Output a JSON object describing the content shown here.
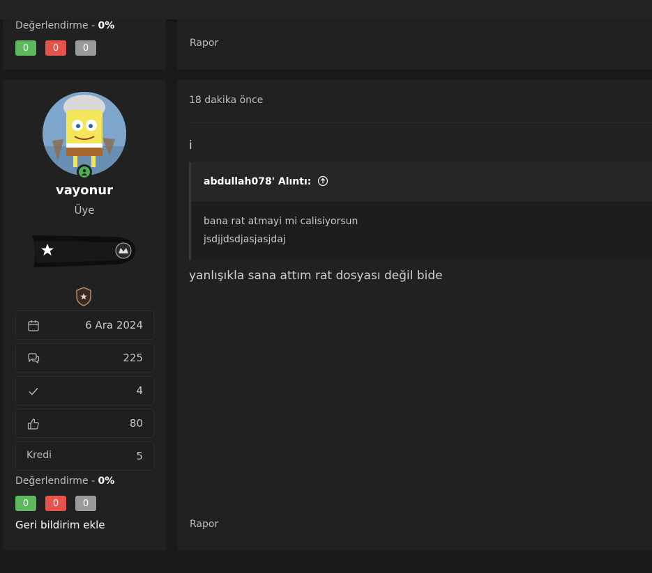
{
  "prev_post": {
    "rating_label": "Değerlendirme -",
    "rating_value": "0%",
    "badges": [
      "0",
      "0",
      "0"
    ],
    "report_label": "Rapor"
  },
  "post": {
    "username": "vayonur",
    "user_title": "Üye",
    "stats": {
      "joined": "6 Ara 2024",
      "messages": "225",
      "solutions": "4",
      "likes": "80",
      "credit_label": "Kredi",
      "credit": "5"
    },
    "rating_label": "Değerlendirme -",
    "rating_value": "0%",
    "badges": [
      "0",
      "0",
      "0"
    ],
    "feedback_label": "Geri bildirim ekle",
    "time": "18 dakika önce",
    "first_line": "i",
    "quote": {
      "author": "abdullah078' Alıntı:",
      "lines": [
        "bana rat atmayi mi calisiyorsun",
        "jsdjjdsdjasjasjdaj"
      ]
    },
    "message": "yanlışıkla sana attım rat dosyası değil bide",
    "report_label": "Rapor"
  },
  "colors": {
    "badge_green": "#5cb85c",
    "badge_red": "#e5534b",
    "badge_gray": "#9a9a9a",
    "online": "#4caf50"
  },
  "icons": [
    "calendar-icon",
    "chat-bubbles-icon",
    "check-icon",
    "thumbs-up-icon",
    "online-status-icon",
    "quote-jump-arrow-icon",
    "rank-shield-icon",
    "star-icon"
  ]
}
